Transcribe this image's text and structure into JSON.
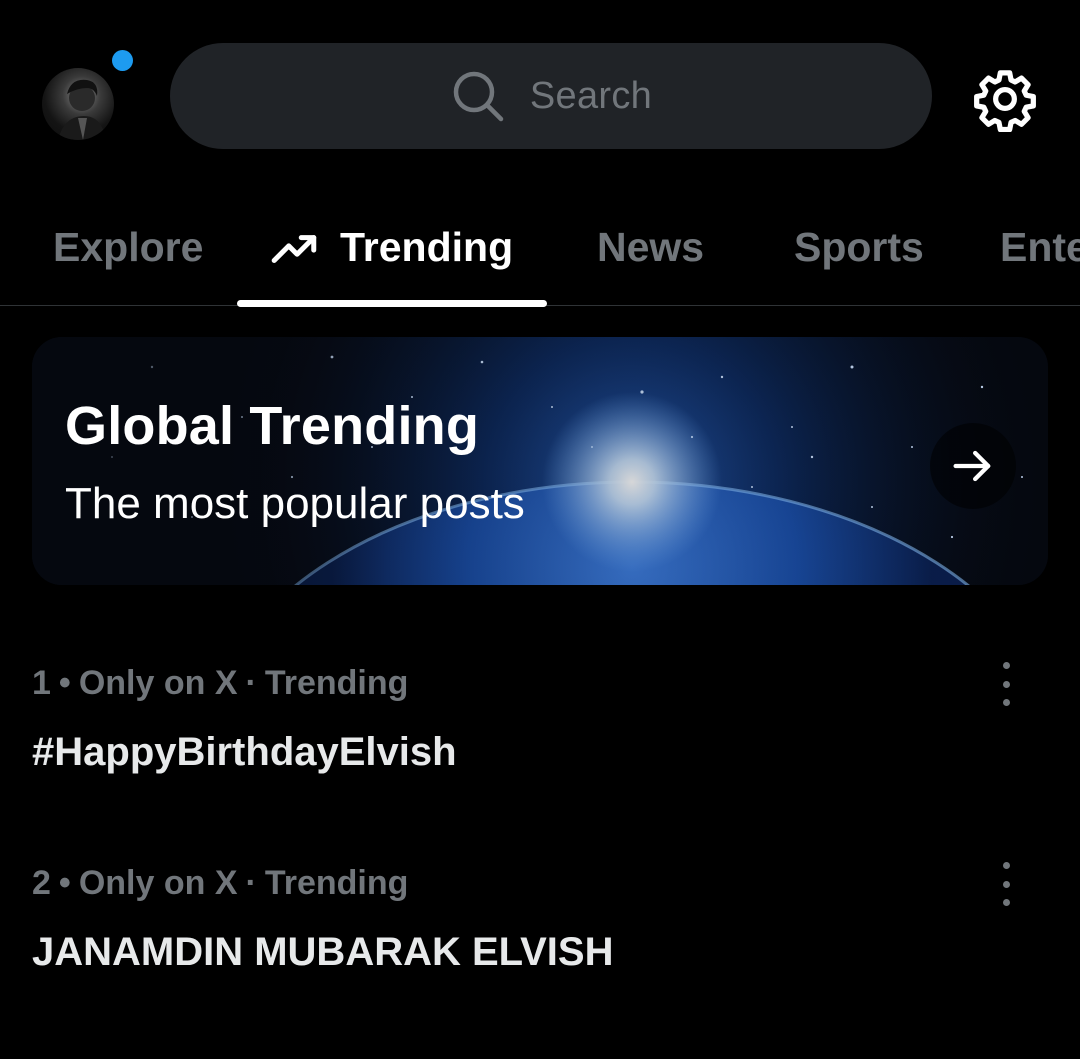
{
  "colors": {
    "accent": "#1d9bf0",
    "background": "#000000",
    "muted_text": "#71767b",
    "primary_text": "#e7e9ea"
  },
  "header": {
    "avatar_icon": "profile-photo",
    "has_notification_dot": true,
    "search": {
      "icon": "search-icon",
      "placeholder": "Search"
    },
    "settings_icon": "gear-icon"
  },
  "tabs": [
    {
      "label": "Explore",
      "active": false
    },
    {
      "label": "Trending",
      "active": true,
      "icon": "trending-arrow-icon"
    },
    {
      "label": "News",
      "active": false
    },
    {
      "label": "Sports",
      "active": false
    },
    {
      "label": "Ente",
      "active": false
    }
  ],
  "banner": {
    "title": "Global Trending",
    "subtitle": "The most popular posts",
    "arrow_icon": "arrow-right-icon"
  },
  "trends": [
    {
      "rank": "1",
      "source": "Only on X",
      "category": "Trending",
      "title": "#HappyBirthdayElvish",
      "more_icon": "more-vertical-icon"
    },
    {
      "rank": "2",
      "source": "Only on X",
      "category": "Trending",
      "title": "JANAMDIN MUBARAK ELVISH",
      "more_icon": "more-vertical-icon"
    }
  ]
}
